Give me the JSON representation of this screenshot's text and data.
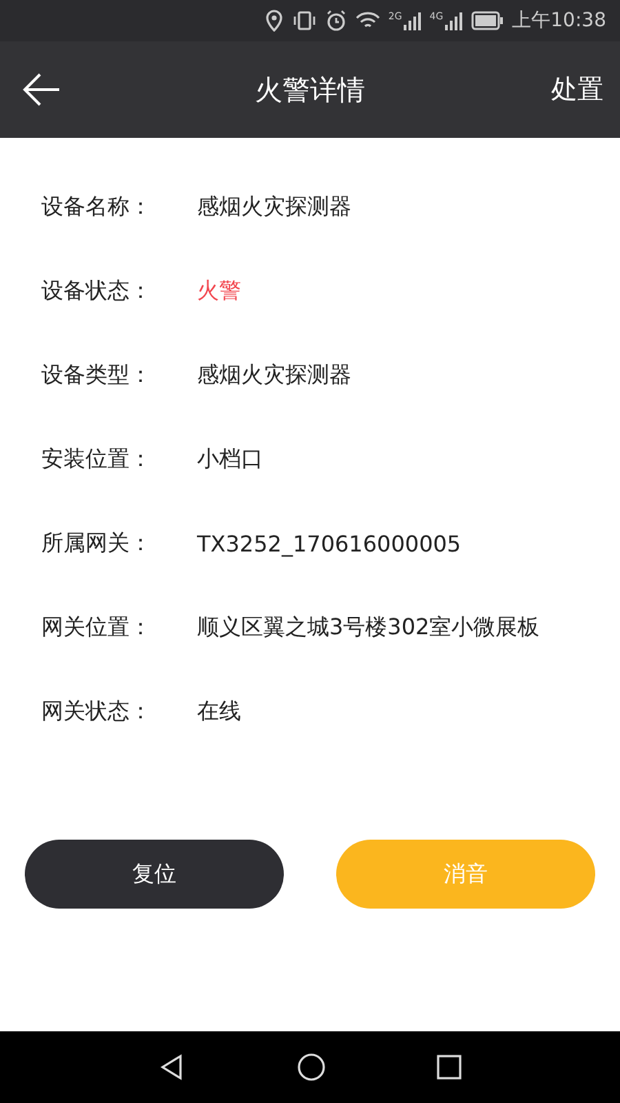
{
  "status_bar": {
    "networks": [
      "2G",
      "4G"
    ],
    "time": "上午10:38"
  },
  "header": {
    "title": "火警详情",
    "action": "处置"
  },
  "fields": [
    {
      "label": "设备名称：",
      "value": "感烟火灾探测器",
      "alarm": false
    },
    {
      "label": "设备状态：",
      "value": "火警",
      "alarm": true
    },
    {
      "label": "设备类型：",
      "value": "感烟火灾探测器",
      "alarm": false
    },
    {
      "label": "安装位置：",
      "value": "小档口",
      "alarm": false
    },
    {
      "label": "所属网关：",
      "value": "TX3252_170616000005",
      "alarm": false
    },
    {
      "label": "网关位置：",
      "value": "顺义区翼之城3号楼302室小微展板",
      "alarm": false
    },
    {
      "label": "网关状态：",
      "value": "在线",
      "alarm": false
    }
  ],
  "buttons": [
    {
      "label": "复位",
      "kind": "dark"
    },
    {
      "label": "消音",
      "kind": "accent"
    }
  ]
}
